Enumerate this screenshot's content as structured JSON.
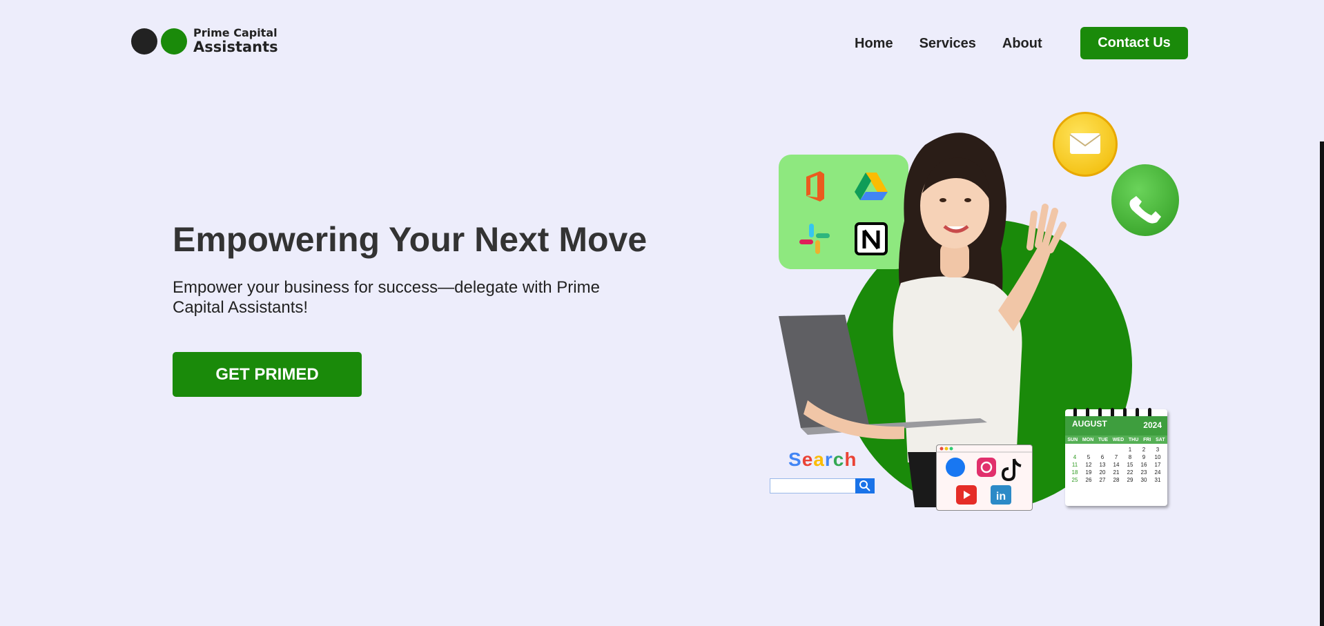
{
  "brand": {
    "line1": "Prime Capital",
    "line2": "Assistants"
  },
  "nav": {
    "items": [
      {
        "label": "Home"
      },
      {
        "label": "Services"
      },
      {
        "label": "About"
      }
    ],
    "contact_label": "Contact Us"
  },
  "hero": {
    "title": "Empowering Your Next Move",
    "subtitle": "Empower your business for success—delegate with Prime Capital Assistants!",
    "cta_label": "GET PRIMED"
  },
  "illustration": {
    "search_label": "Search",
    "calendar": {
      "month": "AUGUST",
      "year": "2024",
      "weekdays": [
        "SUN",
        "MON",
        "TUE",
        "WED",
        "THU",
        "FRI",
        "SAT"
      ],
      "days": [
        "",
        "",
        "",
        "",
        "1",
        "2",
        "3",
        "4",
        "5",
        "6",
        "7",
        "8",
        "9",
        "10",
        "11",
        "12",
        "13",
        "14",
        "15",
        "16",
        "17",
        "18",
        "19",
        "20",
        "21",
        "22",
        "23",
        "24",
        "25",
        "26",
        "27",
        "28",
        "29",
        "30",
        "31"
      ]
    },
    "app_icons": [
      "office-icon",
      "google-drive-icon",
      "slack-icon",
      "notion-icon"
    ],
    "social_icons": [
      "facebook-like-icon",
      "instagram-icon",
      "tiktok-icon",
      "youtube-icon",
      "linkedin-icon"
    ]
  },
  "colors": {
    "brand_green": "#1a8a0a",
    "background": "#ededfb",
    "text_dark": "#333333"
  }
}
